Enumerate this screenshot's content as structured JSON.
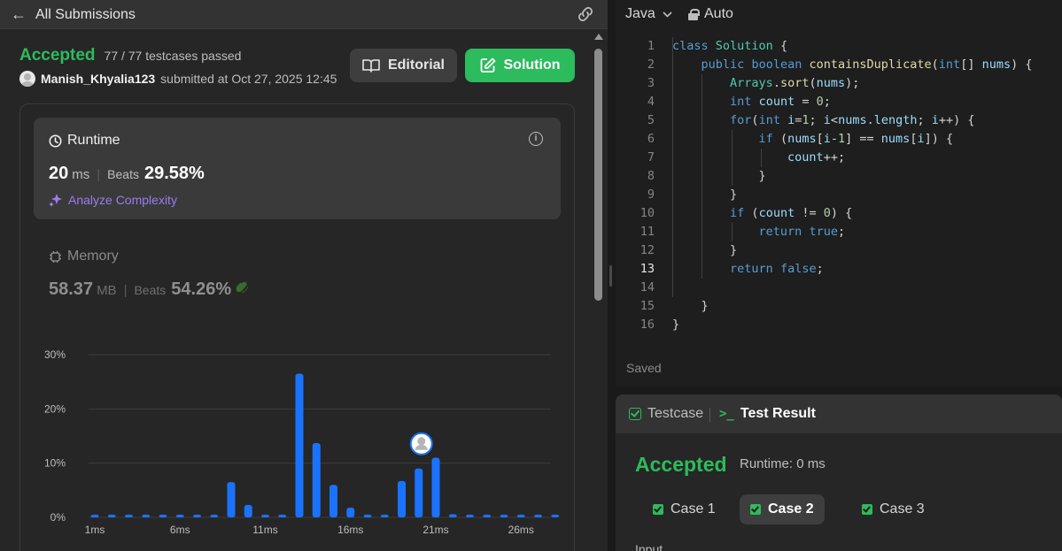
{
  "left_panel": {
    "back_label": "All Submissions",
    "status": "Accepted",
    "testcases": "77 / 77 testcases passed",
    "username": "Manish_Khyalia123",
    "submitted_at": "submitted at Oct 27, 2025 12:45",
    "editorial_label": "Editorial",
    "solution_label": "Solution"
  },
  "runtime": {
    "title": "Runtime",
    "value": "20",
    "unit": "ms",
    "beats_label": "Beats",
    "beats_value": "29.58%",
    "analyze_label": "Analyze Complexity"
  },
  "memory": {
    "title": "Memory",
    "value": "58.37",
    "unit": "MB",
    "beats_label": "Beats",
    "beats_value": "54.26%"
  },
  "colors": {
    "accent_green": "#2cbb5d",
    "bar_blue": "#1a73ff",
    "analyze_purple": "#9a7cf0"
  },
  "chart_data": {
    "type": "bar",
    "x_tick_labels": [
      "1ms",
      "6ms",
      "11ms",
      "16ms",
      "21ms",
      "26ms"
    ],
    "y_tick_labels": [
      "30%",
      "20%",
      "10%",
      "0%"
    ],
    "ylim": [
      0,
      30
    ],
    "categories": [
      "1ms",
      "2ms",
      "3ms",
      "4ms",
      "5ms",
      "6ms",
      "7ms",
      "8ms",
      "9ms",
      "10ms",
      "11ms",
      "12ms",
      "13ms",
      "14ms",
      "15ms",
      "16ms",
      "17ms",
      "18ms",
      "19ms",
      "20ms",
      "21ms",
      "22ms",
      "23ms",
      "24ms",
      "25ms",
      "26ms",
      "27ms",
      "28ms"
    ],
    "values": [
      0.5,
      0.5,
      0.5,
      0.5,
      0.5,
      0.5,
      0.5,
      0.5,
      6.5,
      2.3,
      0.5,
      0.5,
      26.5,
      13.7,
      6.0,
      1.8,
      0.5,
      0.5,
      6.7,
      9.0,
      11.0,
      0.6,
      0.5,
      0.5,
      0.5,
      0.5,
      0.5,
      0.5
    ],
    "highlight": "20ms",
    "grid": true
  },
  "editor": {
    "language": "Java",
    "mode": "Auto",
    "saved": "Saved",
    "active_line": 13,
    "lines": [
      "class Solution {",
      "    public boolean containsDuplicate(int[] nums) {",
      "        Arrays.sort(nums);",
      "        int count = 0;",
      "        for(int i=1; i<nums.length; i++) {",
      "            if (nums[i-1] == nums[i]) {",
      "                count++;",
      "            }",
      "        }",
      "        if (count != 0) {",
      "            return true;",
      "        }",
      "        return false;",
      "",
      "    }",
      "}"
    ]
  },
  "result": {
    "tab_testcase": "Testcase",
    "tab_result": "Test Result",
    "status": "Accepted",
    "runtime": "Runtime: 0 ms",
    "cases": [
      "Case 1",
      "Case 2",
      "Case 3"
    ],
    "active_case": 1,
    "input_label": "Input"
  }
}
